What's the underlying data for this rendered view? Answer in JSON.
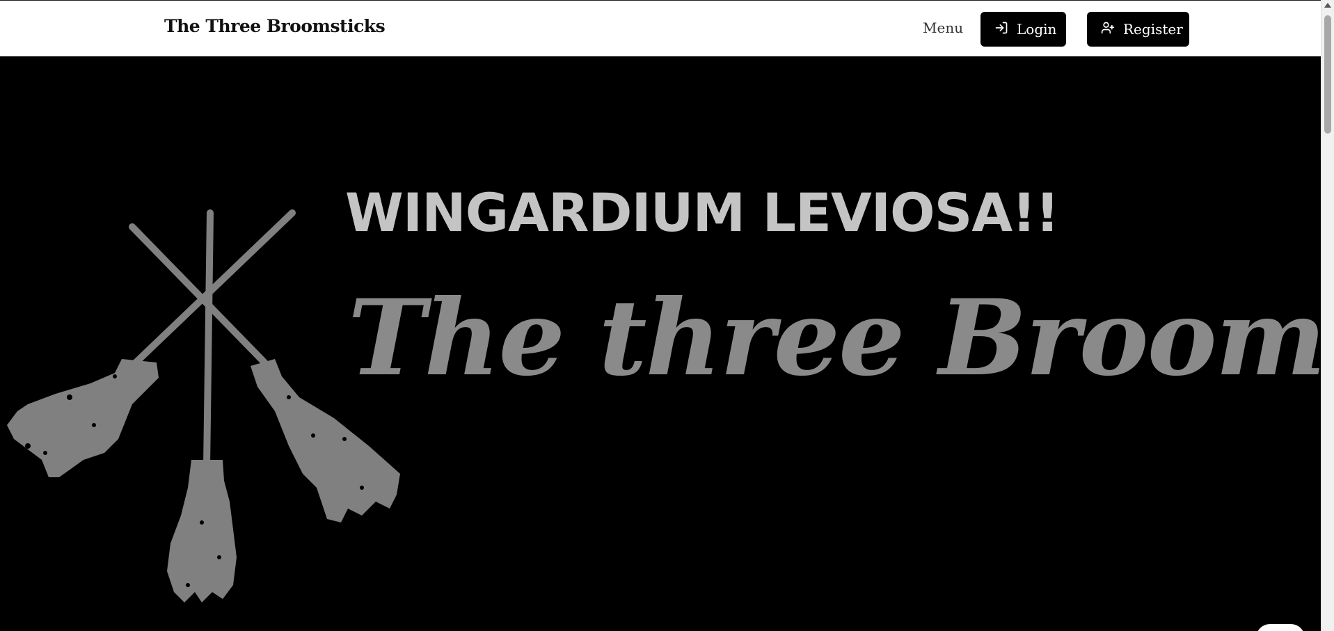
{
  "navbar": {
    "brand": "The Three Broomsticks",
    "menu_label": "Menu",
    "login_label": "Login",
    "register_label": "Register",
    "login_icon": "log-in-icon",
    "register_icon": "user-plus-icon"
  },
  "hero": {
    "kicker": "WINGARDIUM LEVIOSA!!",
    "title": "The three Broomsticks",
    "logo_icon": "crossed-broomsticks-icon"
  },
  "colors": {
    "nav_bg": "#ffffff",
    "button_bg": "#000000",
    "hero_bg": "#000000",
    "kicker": "#c4c4c4",
    "title": "#8a8a8a",
    "logo": "#808080"
  }
}
